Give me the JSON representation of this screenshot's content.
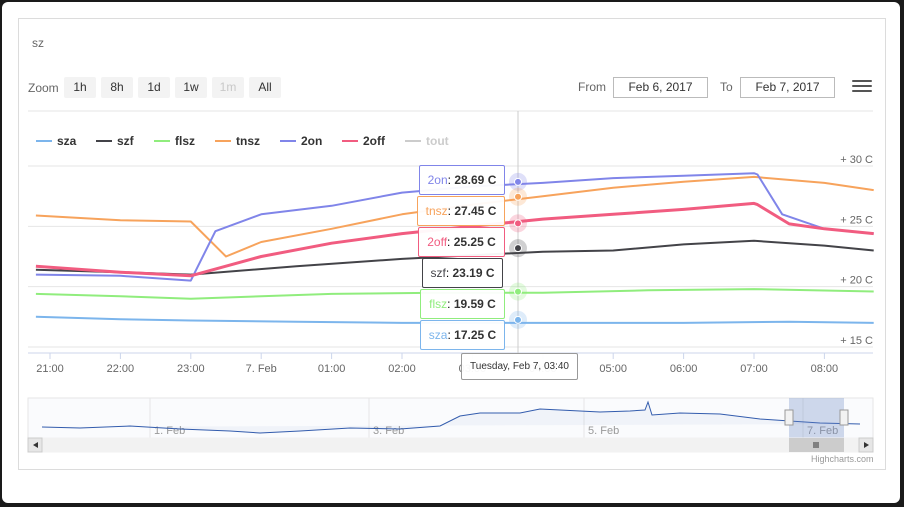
{
  "card": {
    "title": "sz"
  },
  "toolbar": {
    "zoom_label": "Zoom",
    "buttons": [
      {
        "label": "1h",
        "enabled": true
      },
      {
        "label": "8h",
        "enabled": true
      },
      {
        "label": "1d",
        "enabled": true
      },
      {
        "label": "1w",
        "enabled": true
      },
      {
        "label": "1m",
        "enabled": false
      },
      {
        "label": "All",
        "enabled": true
      }
    ],
    "from_label": "From",
    "from_value": "Feb 6, 2017",
    "to_label": "To",
    "to_value": "Feb 7, 2017"
  },
  "colors": {
    "sza": "#7cb5ec",
    "szf": "#434348",
    "flsz": "#90ed7d",
    "tnsz": "#f7a35c",
    "2on": "#8085e9",
    "2off": "#f15c80",
    "tout": "#cccccc",
    "navigator": "#335cad"
  },
  "tooltip": {
    "header": "Tuesday, Feb 7, 03:40",
    "points": [
      {
        "series": "2on",
        "value": "28.69 C"
      },
      {
        "series": "tnsz",
        "value": "27.45 C"
      },
      {
        "series": "2off",
        "value": "25.25 C"
      },
      {
        "series": "szf",
        "value": "23.19 C"
      },
      {
        "series": "flsz",
        "value": "19.59 C"
      },
      {
        "series": "sza",
        "value": "17.25 C"
      }
    ]
  },
  "navigator": {
    "labels": [
      "1. Feb",
      "3. Feb",
      "5. Feb",
      "7. Feb"
    ]
  },
  "credits": "Highcharts.com",
  "chart_data": {
    "type": "line",
    "x_ticks": [
      "21:00",
      "22:00",
      "23:00",
      "7. Feb",
      "01:00",
      "02:00",
      "03:00",
      "04:00",
      "05:00",
      "06:00",
      "07:00",
      "08:00"
    ],
    "y_ticks": [
      "+ 15 C",
      "+ 20 C",
      "+ 25 C",
      "+ 30 C"
    ],
    "ylim": [
      15,
      31.5
    ],
    "grid": true,
    "legend_position": "top-left",
    "series": [
      {
        "name": "sza",
        "visible": true,
        "points": [
          [
            20.8,
            17.5
          ],
          [
            22,
            17.3
          ],
          [
            23,
            17.2
          ],
          [
            24.5,
            17.1
          ],
          [
            26,
            17.0
          ],
          [
            28,
            17.0
          ],
          [
            30,
            17.0
          ],
          [
            31.5,
            17.1
          ],
          [
            32.7,
            17.0
          ]
        ]
      },
      {
        "name": "szf",
        "visible": true,
        "points": [
          [
            20.8,
            21.4
          ],
          [
            22,
            21.2
          ],
          [
            23,
            21.0
          ],
          [
            24.5,
            21.7
          ],
          [
            26,
            22.3
          ],
          [
            27,
            22.6
          ],
          [
            28,
            22.9
          ],
          [
            29,
            23.0
          ],
          [
            30,
            23.5
          ],
          [
            31,
            23.8
          ],
          [
            32,
            23.4
          ],
          [
            32.7,
            23.0
          ]
        ]
      },
      {
        "name": "flsz",
        "visible": true,
        "points": [
          [
            20.8,
            19.4
          ],
          [
            22,
            19.2
          ],
          [
            23,
            19.0
          ],
          [
            24,
            19.2
          ],
          [
            25,
            19.4
          ],
          [
            26.5,
            19.5
          ],
          [
            28,
            19.5
          ],
          [
            29.5,
            19.7
          ],
          [
            31,
            19.8
          ],
          [
            32.7,
            19.6
          ]
        ]
      },
      {
        "name": "tnsz",
        "visible": true,
        "points": [
          [
            20.8,
            25.9
          ],
          [
            22,
            25.5
          ],
          [
            23,
            25.4
          ],
          [
            23.5,
            22.5
          ],
          [
            24,
            23.7
          ],
          [
            25,
            24.8
          ],
          [
            26,
            26.0
          ],
          [
            27,
            26.8
          ],
          [
            28,
            27.5
          ],
          [
            29,
            28.2
          ],
          [
            30,
            28.7
          ],
          [
            31,
            29.1
          ],
          [
            32,
            28.6
          ],
          [
            32.7,
            28.0
          ]
        ]
      },
      {
        "name": "2on",
        "visible": true,
        "points": [
          [
            20.8,
            21.0
          ],
          [
            22,
            20.9
          ],
          [
            23,
            20.5
          ],
          [
            23.35,
            24.6
          ],
          [
            24,
            26.0
          ],
          [
            25,
            26.7
          ],
          [
            26,
            27.8
          ],
          [
            27,
            28.3
          ],
          [
            28,
            28.6
          ],
          [
            29,
            29.0
          ],
          [
            30,
            29.2
          ],
          [
            31,
            29.4
          ],
          [
            31.05,
            29.3
          ],
          [
            31.4,
            26.0
          ],
          [
            32,
            24.8
          ],
          [
            32.7,
            24.4
          ]
        ]
      },
      {
        "name": "2off",
        "visible": true,
        "points": [
          [
            20.8,
            21.7
          ],
          [
            22,
            21.2
          ],
          [
            23,
            20.9
          ],
          [
            24,
            22.5
          ],
          [
            25,
            23.6
          ],
          [
            26,
            24.4
          ],
          [
            27,
            25.0
          ],
          [
            28,
            25.6
          ],
          [
            29,
            26.0
          ],
          [
            30,
            26.4
          ],
          [
            31,
            26.9
          ],
          [
            31.05,
            26.8
          ],
          [
            31.5,
            25.2
          ],
          [
            32,
            24.8
          ],
          [
            32.7,
            24.4
          ]
        ]
      },
      {
        "name": "tout",
        "visible": false,
        "points": []
      }
    ],
    "crosshair_time": "Tuesday, Feb 7, 03:40"
  }
}
